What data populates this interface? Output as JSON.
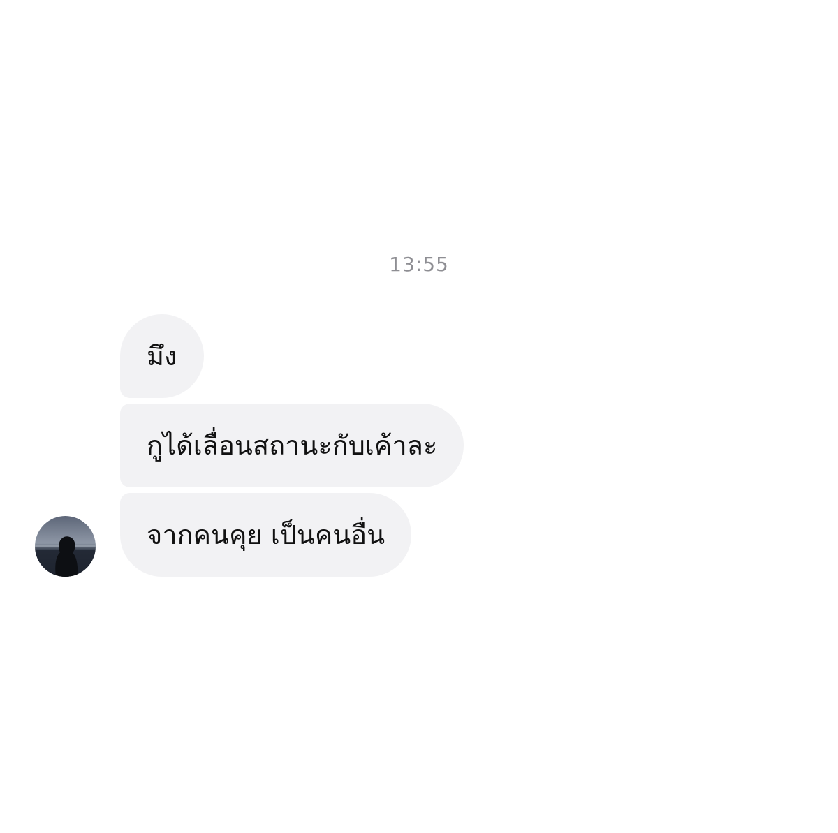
{
  "conversation": {
    "timestamp": "13:55",
    "messages": [
      {
        "text": "มึง"
      },
      {
        "text": "กูได้เลื่อนสถานะกับเค้าละ"
      },
      {
        "text": "จากคนคุย เป็นคนอื่น"
      }
    ],
    "sender_avatar_icon": "profile-photo-silhouette-icon"
  },
  "colors": {
    "background": "#ffffff",
    "bubble": "#f2f2f4",
    "text": "#111111",
    "timestamp": "#8e8e93"
  }
}
